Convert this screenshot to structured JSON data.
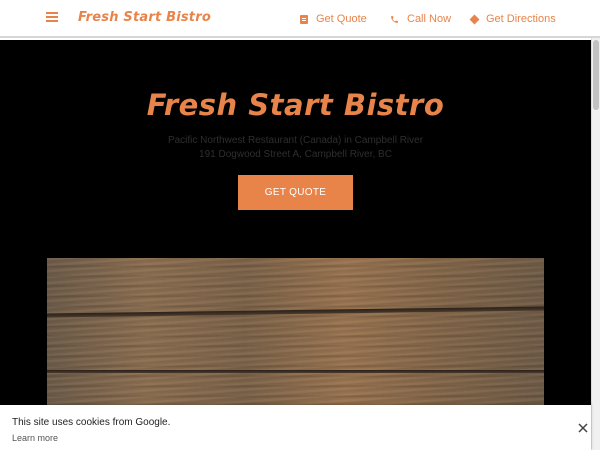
{
  "header": {
    "brand": "Fresh Start Bistro",
    "menu_icon": "hamburger-menu-icon",
    "nav": [
      {
        "label": "Get Quote",
        "icon": "document-icon"
      },
      {
        "label": "Call Now",
        "icon": "phone-icon"
      },
      {
        "label": "Get Directions",
        "icon": "directions-icon"
      }
    ]
  },
  "hero": {
    "title": "Fresh Start Bistro",
    "subtitle_line1": "Pacific Northwest Restaurant (Canada) in Campbell River",
    "subtitle_line2": "191 Dogwood Street A, Campbell River, BC",
    "cta_label": "Get Quote"
  },
  "cookie_banner": {
    "message": "This site uses cookies from Google.",
    "link": "Learn more",
    "close_icon": "close-icon"
  },
  "colors": {
    "accent": "#e8844a",
    "hero_background": "#000000",
    "subtitle_text": "#2e2e2e"
  }
}
